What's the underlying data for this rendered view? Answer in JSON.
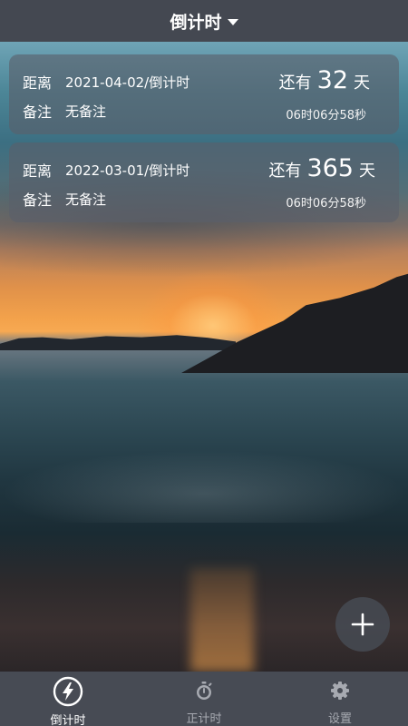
{
  "header": {
    "title": "倒计时"
  },
  "cards": [
    {
      "label_target": "距离",
      "target": "2021-04-02/倒计时",
      "label_note": "备注",
      "note": "无备注",
      "remain_prefix": "还有",
      "days": "32",
      "days_unit": "天",
      "hms": "06时06分58秒"
    },
    {
      "label_target": "距离",
      "target": "2022-03-01/倒计时",
      "label_note": "备注",
      "note": "无备注",
      "remain_prefix": "还有",
      "days": "365",
      "days_unit": "天",
      "hms": "06时06分58秒"
    }
  ],
  "fab": {
    "icon": "plus-icon"
  },
  "tabs": [
    {
      "label": "倒计时",
      "icon": "lightning-icon",
      "active": true
    },
    {
      "label": "正计时",
      "icon": "stopwatch-icon",
      "active": false
    },
    {
      "label": "设置",
      "icon": "gear-icon",
      "active": false
    }
  ],
  "colors": {
    "topbar": "#444851",
    "tabbar": "#474b54",
    "card_bg": "rgba(90,96,106,0.62)",
    "tab_inactive": "#a7aab1",
    "tab_active": "#ffffff"
  }
}
